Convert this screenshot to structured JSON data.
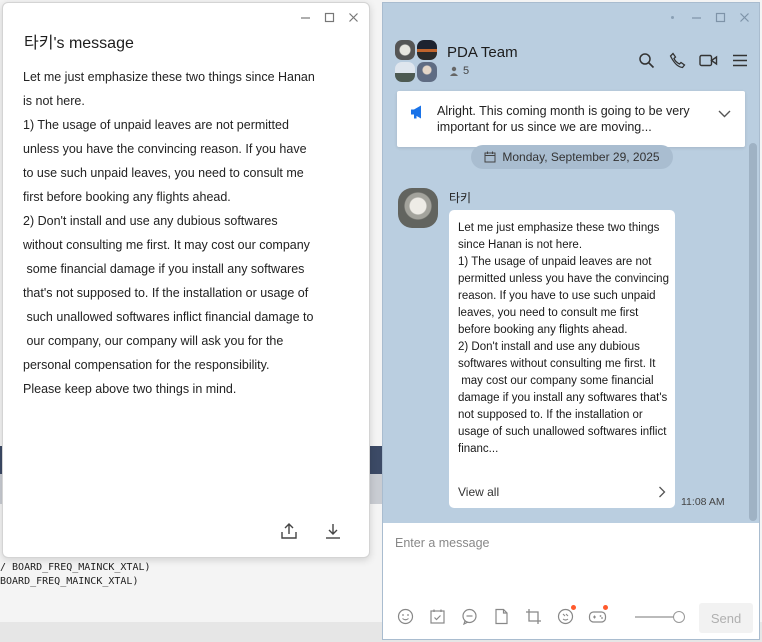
{
  "background": {
    "code_lines": [
      "/ BOARD_FREQ_MAINCK_XTAL)",
      "BOARD_FREQ_MAINCK_XTAL)"
    ]
  },
  "popup": {
    "title": "타키's message",
    "body": "Let me just emphasize these two things since Hanan\nis not here.\n1) The usage of unpaid leaves are not permitted\nunless you have the convincing reason. If you have\nto use such unpaid leaves, you need to consult me\nfirst before booking any flights ahead.\n2) Don't install and use any dubious softwares\nwithout consulting me first. It may cost our company\n some financial damage if you install any softwares\nthat's not supposed to. If the installation or usage of\n such unallowed softwares inflict financial damage to\n our company, our company will ask you for the\npersonal compensation for the responsibility.\nPlease keep above two things in mind.",
    "share_icon": "share-icon",
    "download_icon": "download-icon"
  },
  "chat": {
    "title": "PDA Team",
    "member_count": "5",
    "notice": "Alright. This coming month is going to be very important for us since we are moving...",
    "date": "Monday, September 29, 2025",
    "message": {
      "sender": "타키",
      "text": "Let me just emphasize these two things since Hanan is not here.\n1) The usage of unpaid leaves are not permitted unless you have the convincing reason. If you have to use such unpaid leaves, you need to consult me first before booking any flights ahead.\n2) Don't install and use any dubious softwares without consulting me first. It\n may cost our company some financial damage if you install any softwares that's not supposed to. If the installation or usage of such unallowed softwares inflict financ...",
      "view_all": "View all",
      "time": "11:08 AM"
    },
    "input_placeholder": "Enter a message",
    "send_label": "Send",
    "colors": {
      "chat_bg": "#bacee0",
      "notice_icon": "#1a73e8",
      "badge": "#ff5a2d"
    }
  }
}
